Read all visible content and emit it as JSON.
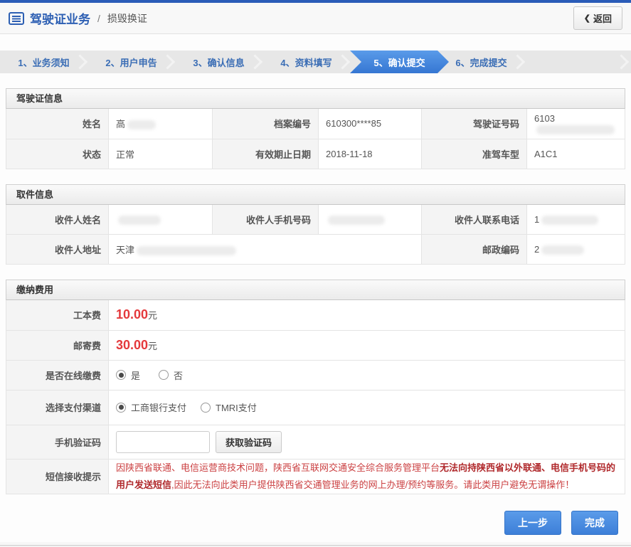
{
  "colors": {
    "top_border": "#2b5cb8",
    "accent_blue": "#2d5fb3",
    "active_step_blue": "#4189e0",
    "fee_red": "#e4393c",
    "notice_red": "#cb4042"
  },
  "header": {
    "title": "驾驶证业务",
    "divider": "/",
    "subtitle": "损毁换证",
    "back_chevron": "❮",
    "back_label": "返回"
  },
  "steps": {
    "s1": "1、业务须知",
    "s2": "2、用户申告",
    "s3": "3、确认信息",
    "s4": "4、资料填写",
    "s5": "5、确认提交",
    "s6": "6、完成提交",
    "active_step": "5、确认提交"
  },
  "license": {
    "title": "驾驶证信息",
    "name_label": "姓名",
    "name_value_prefix": "高",
    "file_label": "档案编号",
    "file_value": "610300****85",
    "license_no_label": "驾驶证号码",
    "license_no_value_prefix": "6103",
    "status_label": "状态",
    "status_value": "正常",
    "expiry_label": "有效期止日期",
    "expiry_value": "2018-11-18",
    "vehicle_label": "准驾车型",
    "vehicle_value": "A1C1"
  },
  "pickup": {
    "title": "取件信息",
    "recipient_name_label": "收件人姓名",
    "mobile_label": "收件人手机号码",
    "phone_label": "收件人联系电话",
    "phone_value_prefix": "1",
    "address_label": "收件人地址",
    "address_value_prefix": "天津",
    "postcode_label": "邮政编码",
    "postcode_value_prefix": "2"
  },
  "fees": {
    "title": "缴纳费用",
    "production_fee_label": "工本费",
    "production_fee_value": "10.00",
    "production_fee_unit": "元",
    "mail_fee_label": "邮寄费",
    "mail_fee_value": "30.00",
    "mail_fee_unit": "元",
    "online_pay_label": "是否在线缴费",
    "online_yes": "是",
    "online_no": "否",
    "channel_label": "选择支付渠道",
    "channel_icbc": "工商银行支付",
    "channel_tmri": "TMRI支付",
    "sms_code_label": "手机验证码",
    "sms_code_value": "",
    "get_code_label": "获取验证码",
    "notice_label": "短信接收提示",
    "notice_part1": "因陕西省联通、电信运营商技术问题，陕西省互联网交通安全综合服务管理平台",
    "notice_part2": "无法向持陕西省以外联通、电信手机号码的用户发送短信",
    "notice_part3": ",因此无法向此类用户提供陕西省交通管理业务的网上办理/预约等服务。请此类用户避免无谓操作！"
  },
  "footer": {
    "prev_label": "上一步",
    "finish_label": "完成"
  }
}
